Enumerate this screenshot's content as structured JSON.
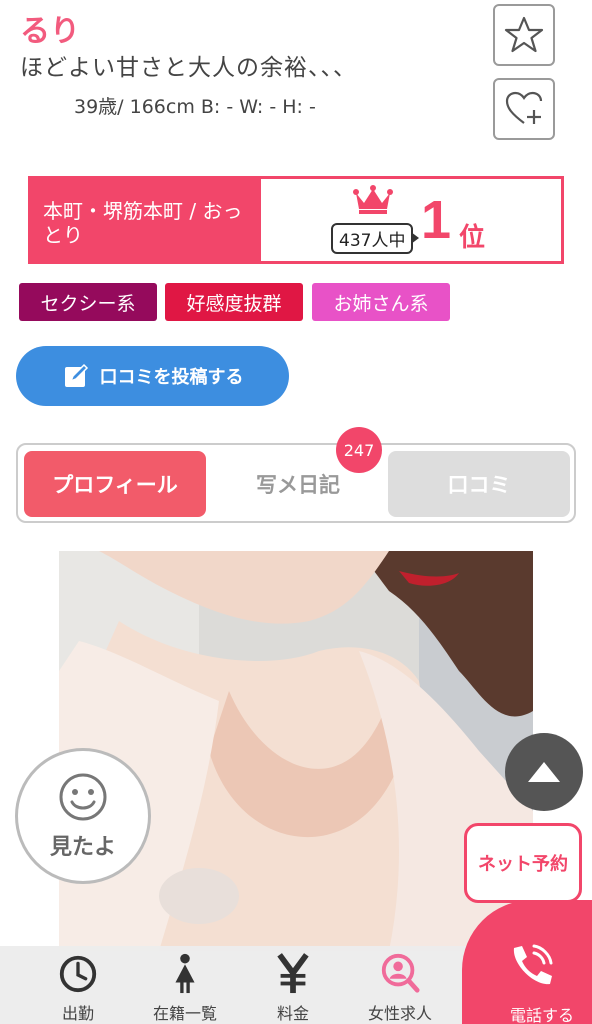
{
  "profile": {
    "name": "るり",
    "catchphrase": "ほどよい甘さと大人の余裕、、、",
    "stats": "39歳/ 166cm B: - W: - H: -"
  },
  "ranking": {
    "area": "本町・堺筋本町 / おっとり",
    "count": "437人中",
    "rank": "1",
    "rank_unit": "位"
  },
  "tags": [
    {
      "label": "セクシー系",
      "color": "#950a5c"
    },
    {
      "label": "好感度抜群",
      "color": "#e01744"
    },
    {
      "label": "お姉さん系",
      "color": "#e852c7"
    }
  ],
  "review_button": {
    "label": "口コミを投稿する"
  },
  "tabs": [
    {
      "label": "プロフィール",
      "state": "active"
    },
    {
      "label": "写メ日記",
      "state": "normal"
    },
    {
      "label": "口コミ",
      "state": "disabled"
    }
  ],
  "diary_badge": "247",
  "mita_button": {
    "label": "見たよ"
  },
  "net_reserve": {
    "label": "ネット予約"
  },
  "bottom_nav": [
    {
      "label": "出勤",
      "icon": "clock-icon"
    },
    {
      "label": "在籍一覧",
      "icon": "woman-icon"
    },
    {
      "label": "料金",
      "icon": "yen-icon"
    },
    {
      "label": "女性求人",
      "icon": "search-person-icon"
    }
  ],
  "call_button": {
    "label": "電話する"
  },
  "colors": {
    "accent": "#f2466a",
    "blue": "#3d8ee0",
    "tab_active": "#f25b6a"
  }
}
